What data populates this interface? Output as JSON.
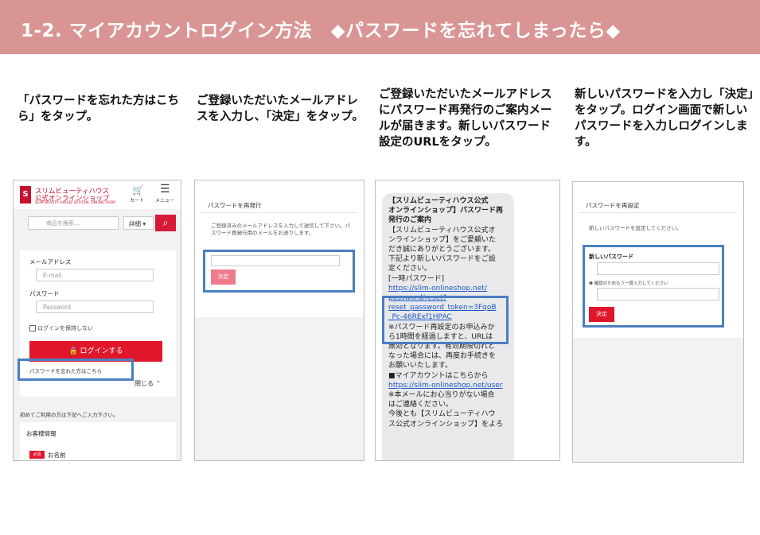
{
  "header": {
    "title": "1-2. マイアカウントログイン方法　◆パスワードを忘れてしまったら◆"
  },
  "steps": [
    {
      "text": "「パスワードを忘れた方はこちら」をタップ。"
    },
    {
      "text": "ご登録いただいたメールアドレスを入力し、「決定」をタップ。"
    },
    {
      "text": "ご登録いただいたメールアドレスにパスワード再発行のご案内メールが届きます。新しいパスワード設定のURLをタップ。"
    },
    {
      "text": "新しいパスワードを入力し「決定」をタップ。ログイン画面で新しいパスワードを入力しログインします。"
    }
  ],
  "shot1": {
    "logo_letter": "S",
    "brand_line1": "スリムビューティハウス",
    "brand_line2": "公式オンラインショップ",
    "brand_line3": "SLIM BEAUTY HOUSE OFFICIAL ONLINE SHOP",
    "cart_label": "カート",
    "menu_label": "メニュー",
    "search_placeholder": "商品を検索...",
    "detail_label": "詳細 ▾",
    "email_label": "メールアドレス",
    "email_placeholder": "E-mail",
    "password_label": "パスワード",
    "password_placeholder": "Password",
    "keep_login": "ログインを保持しない",
    "login_button": "🔒 ログインする",
    "forgot_link": "パスワードを忘れた方はこちら",
    "close_label": "閉じる ⌃",
    "first_time": "初めてご利用の方は下記へご入力下さい。",
    "customer_info": "お客様情報",
    "required_badge": "必須",
    "name_label": "お名前"
  },
  "shot2": {
    "title": "パスワードを再発行",
    "description": "ご登録済みのメールアドレスを入力して送信して下さい。パスワード再発行用のメールをお送りします。",
    "submit": "決定"
  },
  "shot3": {
    "lines": [
      {
        "t": "【スリムビューティハウス公式",
        "c": "b"
      },
      {
        "t": "オンラインショップ】パスワード再",
        "c": "b"
      },
      {
        "t": "発行のご案内",
        "c": "b"
      },
      {
        "t": "【スリムビューティハウス公式オ",
        "c": ""
      },
      {
        "t": "ンラインショップ】をご愛顧いた",
        "c": ""
      },
      {
        "t": "だき誠にありがとうございます。",
        "c": ""
      },
      {
        "t": " ",
        "c": ""
      },
      {
        "t": "下記より新しいパスワードをご設",
        "c": ""
      },
      {
        "t": "定ください。",
        "c": ""
      },
      {
        "t": "[一時パスワード]",
        "c": ""
      },
      {
        "t": "https://slim-onlineshop.net/",
        "c": "lnk"
      },
      {
        "t": "password/reset?",
        "c": "lnk"
      },
      {
        "t": "reset_password_token=3FqoB",
        "c": "lnk"
      },
      {
        "t": "_Pc-46RExf1HPAC",
        "c": "lnk"
      },
      {
        "t": "※パスワード再設定のお申込みか",
        "c": ""
      },
      {
        "t": "ら1時間を経過しますと、URLは",
        "c": ""
      },
      {
        "t": "無効となります。有効期限切れと",
        "c": ""
      },
      {
        "t": "なった場合には、再度お手続きを",
        "c": ""
      },
      {
        "t": "お願いいたします。",
        "c": ""
      },
      {
        "t": " ",
        "c": ""
      },
      {
        "t": "■マイアカウントはこちらから",
        "c": ""
      },
      {
        "t": "https://slim-onlineshop.net/user",
        "c": "lnk"
      },
      {
        "t": " ",
        "c": ""
      },
      {
        "t": "※本メールにお心当りがない場合",
        "c": ""
      },
      {
        "t": "はご連絡ください。",
        "c": ""
      },
      {
        "t": "今後とも【スリムビューティハウ",
        "c": ""
      },
      {
        "t": "ス公式オンラインショップ】をよろ",
        "c": ""
      }
    ]
  },
  "shot4": {
    "title": "パスワードを再設定",
    "description": "新しいパスワードを設定してください。",
    "new_password_label": "新しいパスワード",
    "confirm_label": "❶ 確認のためもう一度入力してください",
    "submit": "決定"
  },
  "colors": {
    "header_bg": "#d99494",
    "brand_red": "#e0162b",
    "highlight_blue": "#4a7fc1"
  }
}
